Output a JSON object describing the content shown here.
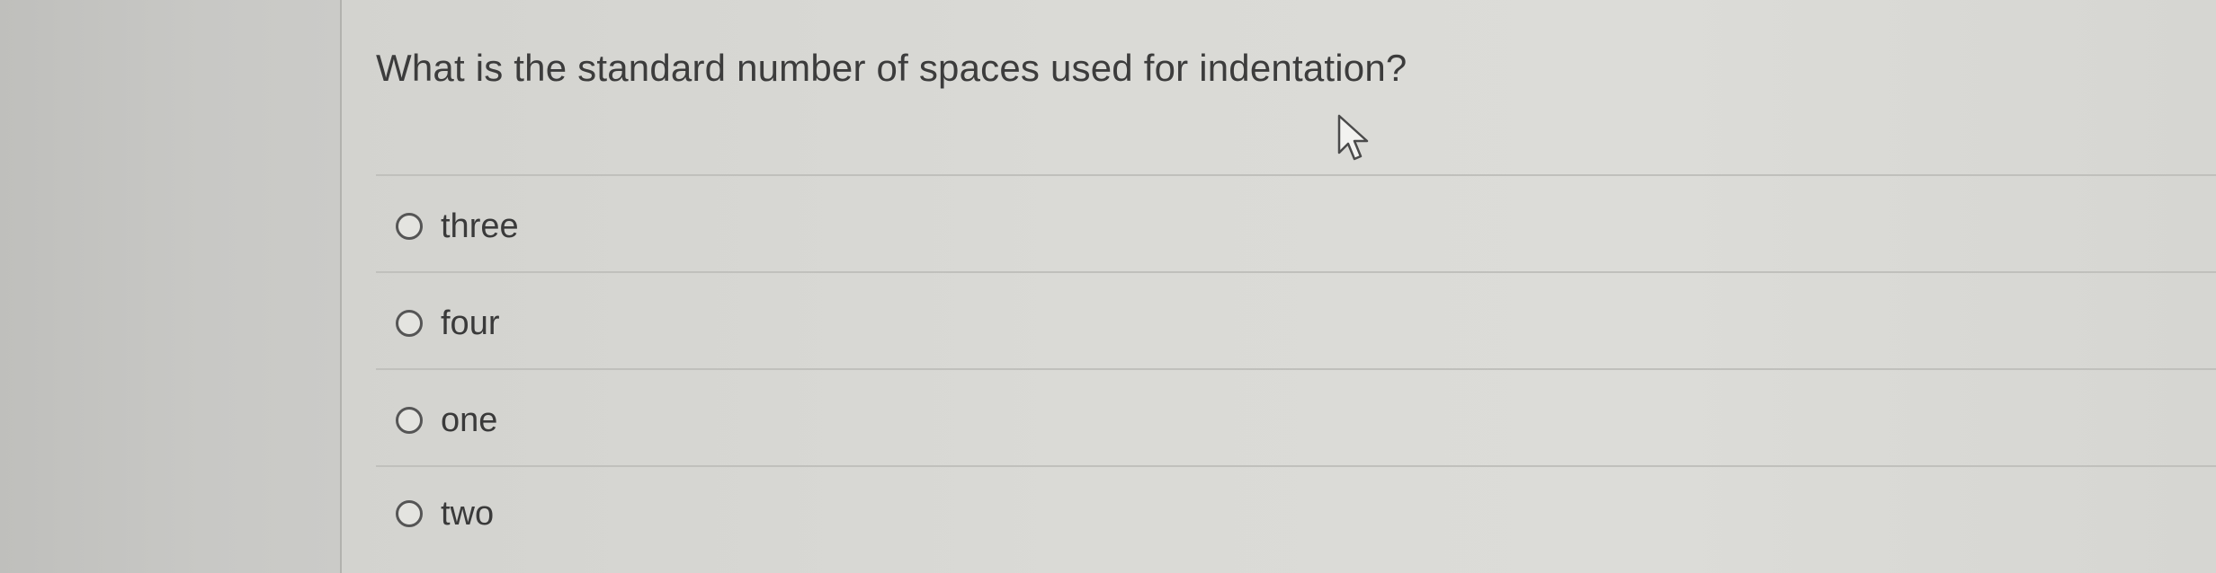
{
  "question": {
    "text": "What is the standard number of spaces used for indentation?"
  },
  "options": [
    {
      "label": "three",
      "selected": false
    },
    {
      "label": "four",
      "selected": false
    },
    {
      "label": "one",
      "selected": false
    },
    {
      "label": "two",
      "selected": false
    }
  ],
  "cursor": {
    "icon": "mouse-pointer-icon"
  }
}
